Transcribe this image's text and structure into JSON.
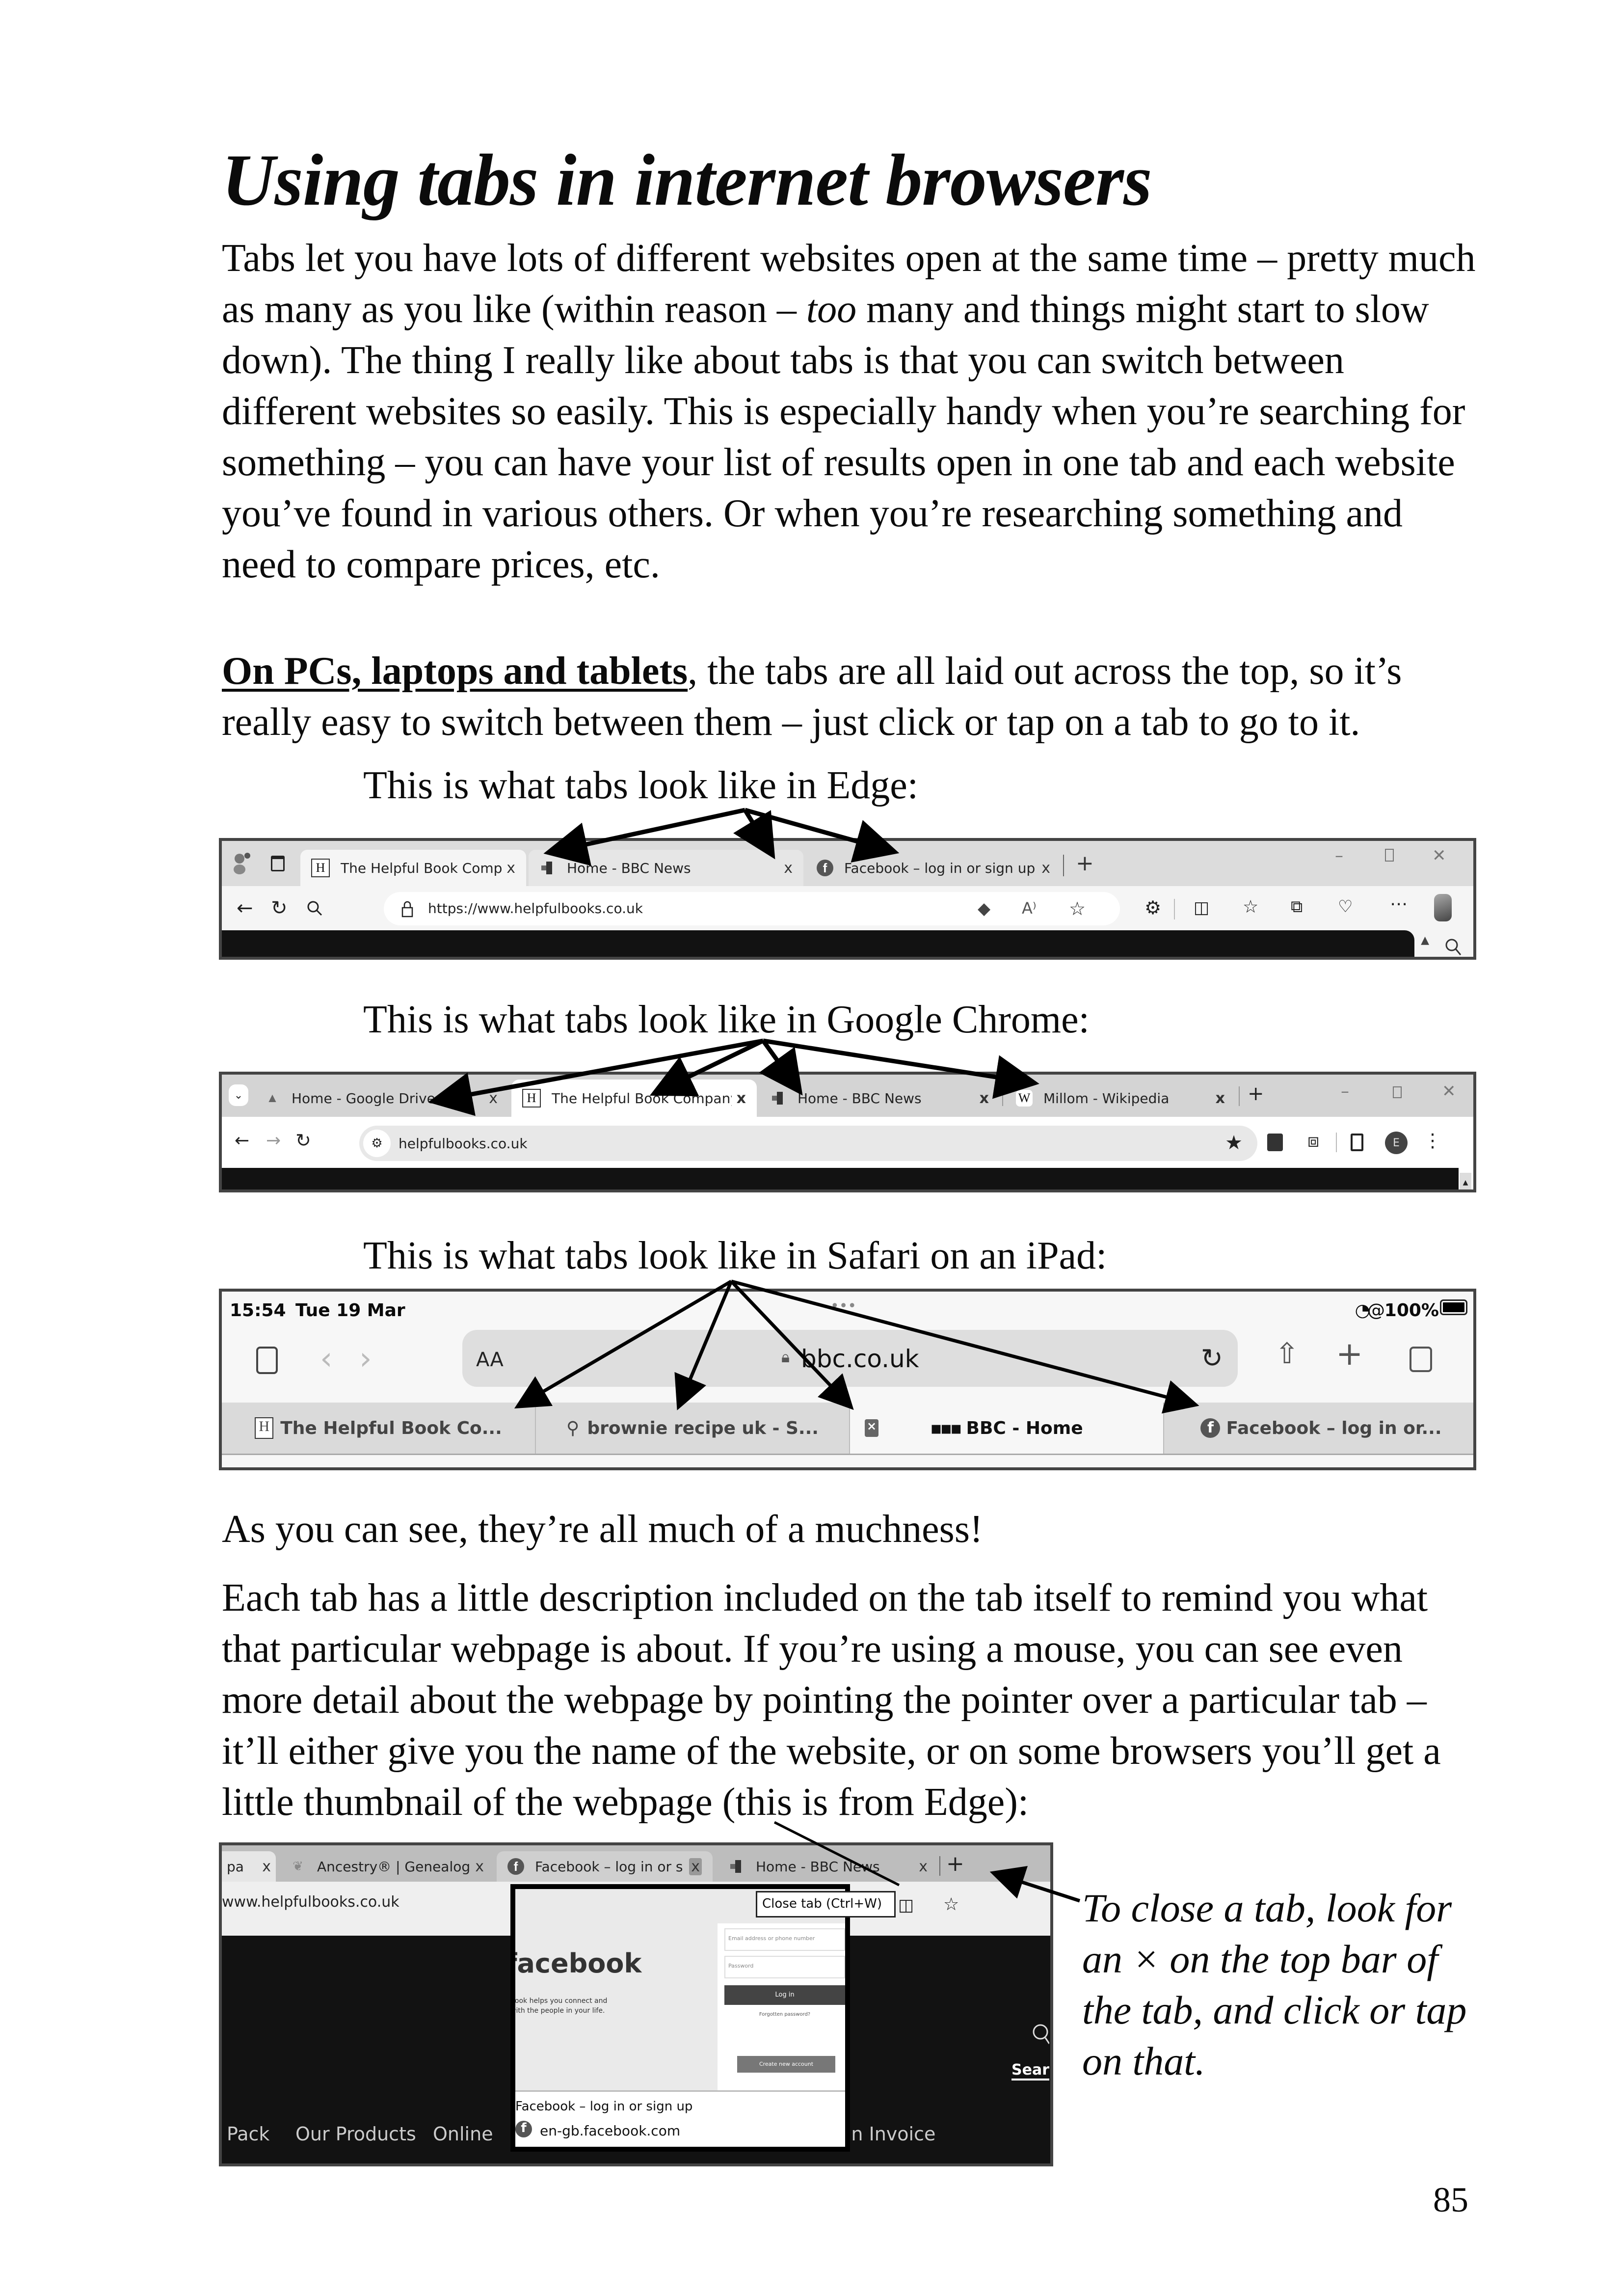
{
  "page": {
    "title": "Using tabs in internet browsers",
    "intro_paragraph": {
      "part1": "Tabs let you have lots of different websites open at the same time – pretty much as many as you like (within reason – ",
      "emphasis": "too",
      "part2": " many and things might start to slow down).  The thing I really like about tabs is that you can switch between different websites so easily.  This is especially handy when you’re searching for something – you can have your list of results open in one tab and each website you’ve found in various others.  Or when you’re researching something and need to compare prices, etc."
    },
    "pcs_paragraph": {
      "lead": "On PCs, laptops and tablets",
      "rest": ", the tabs are all laid out across the top, so it’s really easy to switch between them – just click or tap on a tab to go to it."
    },
    "captions": {
      "edge": "This is what tabs look like in Edge:",
      "chrome": "This is what tabs look like in Google Chrome:",
      "safari": "This is what tabs look like in Safari on an iPad:"
    },
    "muchness": "As you can see, they’re all much of a muchness!",
    "description_paragraph": "Each tab has a little description included on the tab itself to remind you what that particular webpage is about.  If you’re using a mouse, you can see even more detail about the webpage by pointing the pointer over a particular tab – it’ll either give you the name of the website, or on some browsers you’ll get a little thumbnail of the webpage (this is from Edge):",
    "side_note": "To close a tab, look for an × on the top bar of the tab, and click or tap on that.",
    "page_number": "85"
  },
  "edge": {
    "tabs": [
      {
        "label": "The Helpful Book Company",
        "favicon": "H",
        "active": true
      },
      {
        "label": "Home - BBC News",
        "favicon": "bbc-icon",
        "active": false
      },
      {
        "label": "Facebook – log in or sign up",
        "favicon": "f",
        "active": false
      }
    ],
    "close_glyph": "x",
    "new_tab": "+",
    "url": "https://www.helpfulbooks.co.uk",
    "read_aloud": "A⁾",
    "more": "⋯"
  },
  "chrome": {
    "tabs": [
      {
        "label": "Home - Google Drive",
        "favicon": "drive-icon",
        "active": false
      },
      {
        "label": "The Helpful Book Company",
        "favicon": "H",
        "active": true
      },
      {
        "label": "Home - BBC News",
        "favicon": "bbc-icon",
        "active": false
      },
      {
        "label": "Millom - Wikipedia",
        "favicon": "W",
        "active": false
      }
    ],
    "url": "helpfulbooks.co.uk",
    "profile_initial": "E"
  },
  "safari": {
    "time": "15:54",
    "date": "Tue 19 Mar",
    "battery": "100%",
    "aa": "AA",
    "url": "bbc.co.uk",
    "tabs": [
      {
        "label": "The Helpful Book Co...",
        "favicon": "H",
        "active": false
      },
      {
        "label": "brownie recipe uk - S...",
        "favicon": "search-icon",
        "active": false
      },
      {
        "label": "BBC - Home",
        "favicon": "bbc-icon",
        "active": true
      },
      {
        "label": "Facebook – log in or...",
        "favicon": "f",
        "active": false
      }
    ]
  },
  "edge_hover": {
    "tabs": [
      {
        "label": "pa"
      },
      {
        "label": "Ancestry® | Genealogy, F"
      },
      {
        "label": "Facebook – log in or sign"
      },
      {
        "label": "Home - BBC News"
      }
    ],
    "url": "www.helpfulbooks.co.uk",
    "tooltip": "Close tab (Ctrl+W)",
    "preview": {
      "brand": "facebook",
      "tagline_line1": "book helps you connect and",
      "tagline_line2": "with the people in your life.",
      "email_placeholder": "Email address or phone number",
      "password_placeholder": "Password",
      "login_button": "Log in",
      "forgotten": "Forgotten password?",
      "create_account": "Create new account",
      "page_title": "Facebook – log in or sign up",
      "domain": "en-gb.facebook.com"
    },
    "nav_links": [
      "Pack",
      "Our Products",
      "Online",
      "Pay an Invoice"
    ],
    "search_label": "Sear"
  }
}
